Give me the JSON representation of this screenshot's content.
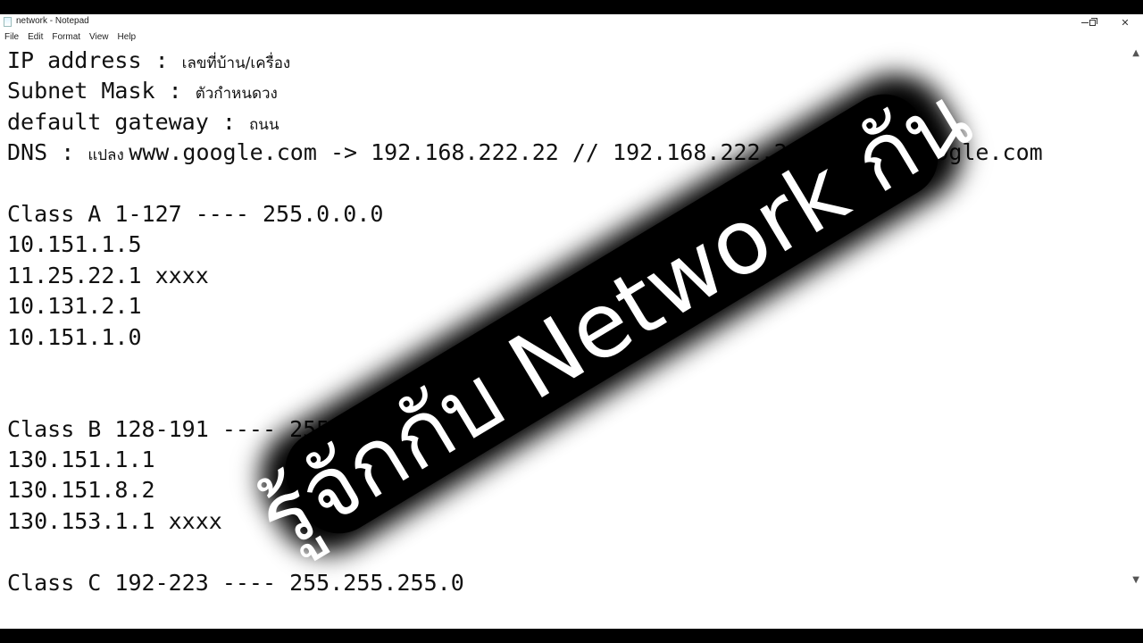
{
  "window": {
    "title": "network - Notepad",
    "controls": {
      "minimize": "minimize",
      "maximize": "restore",
      "close": "close"
    }
  },
  "menu": [
    "File",
    "Edit",
    "Format",
    "View",
    "Help"
  ],
  "document": {
    "lines": [
      {
        "mono": "IP address : ",
        "thai": "เลขที่บ้าน/เครื่อง"
      },
      {
        "mono": "Subnet Mask : ",
        "thai": "ตัวกำหนดวง"
      },
      {
        "mono": "default gateway : ",
        "thai": "ถนน"
      },
      {
        "mono": "DNS : ",
        "thai": "แปลง ",
        "rest": "www.google.com -> 192.168.222.22 // 192.168.222.22 -> www.google.com"
      },
      {
        "mono": ""
      },
      {
        "mono": "Class A 1-127 ---- 255.0.0.0"
      },
      {
        "mono": "10.151.1.5"
      },
      {
        "mono": "11.25.22.1 xxxx"
      },
      {
        "mono": "10.131.2.1"
      },
      {
        "mono": "10.151.1.0"
      },
      {
        "mono": ""
      },
      {
        "mono": ""
      },
      {
        "mono": "Class B 128-191 ---- 255.255.0.0"
      },
      {
        "mono": "130.151.1.1"
      },
      {
        "mono": "130.151.8.2"
      },
      {
        "mono": "130.153.1.1 xxxx"
      },
      {
        "mono": ""
      },
      {
        "mono": "Class C 192-223 ---- 255.255.255.0"
      }
    ]
  },
  "overlay": {
    "text": "รู้จักกับ Network กัน",
    "text_color": "#ffffff",
    "background_color": "#000000"
  },
  "scrollbar": {
    "up": "^",
    "down": "v"
  }
}
